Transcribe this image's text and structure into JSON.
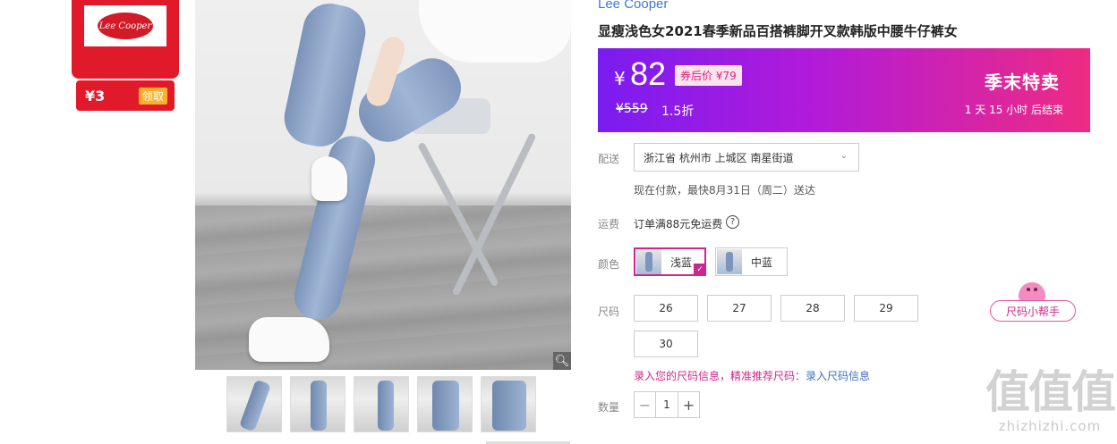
{
  "store": {
    "logo_text": "Lee Cooper",
    "coupon_amount": "¥3",
    "coupon_button": "领取"
  },
  "product": {
    "brand": "Lee Cooper",
    "title": "显瘦浅色女2021春季新品百搭裤脚开叉款韩版中腰牛仔裤女",
    "thumbnails": [
      "thumb-1",
      "thumb-2",
      "thumb-3",
      "thumb-4",
      "thumb-5"
    ]
  },
  "promo": {
    "currency": "¥",
    "price": "82",
    "coupon_price": "券后价 ¥79",
    "original_price": "¥559",
    "discount": "1.5折",
    "event": "季末特卖",
    "countdown": "1 天 15 小时 后结束",
    "colors": {
      "start": "#7a1cf0",
      "mid": "#b31bd8",
      "end": "#ee2b82"
    }
  },
  "delivery": {
    "label": "配送",
    "address": "浙江省 杭州市 上城区 南星街道",
    "note": "现在付款，最快8月31日（周二）送达"
  },
  "shipping": {
    "label": "运费",
    "text": "订单满88元免运费",
    "help_icon": "?"
  },
  "color": {
    "label": "颜色",
    "options": [
      {
        "name": "浅蓝",
        "selected": true
      },
      {
        "name": "中蓝",
        "selected": false
      }
    ]
  },
  "size": {
    "label": "尺码",
    "options": [
      "26",
      "27",
      "28",
      "29",
      "30"
    ],
    "hint": "录入您的尺码信息，精准推荐尺码：",
    "hint_link": "录入尺码信息",
    "helper": "尺码小帮手"
  },
  "quantity": {
    "label": "数量",
    "value": "1",
    "minus": "−",
    "plus": "+"
  },
  "watermark": {
    "glyph": "值值值",
    "url": "zhizhizhi.com"
  }
}
